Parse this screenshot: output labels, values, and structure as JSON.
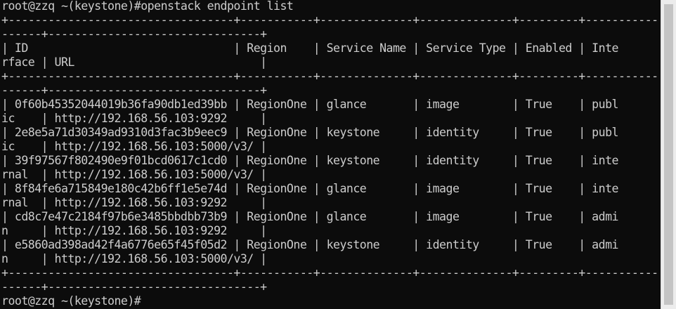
{
  "terminal": {
    "lines": [
      "root@zzq ~(keystone)#openstack endpoint list",
      "+----------------------------------+-----------+--------------+--------------+---------+-----------",
      "------+--------------------------------+",
      "| ID                               | Region    | Service Name | Service Type | Enabled | Inte",
      "rface | URL                            |",
      "+----------------------------------+-----------+--------------+--------------+---------+-----------",
      "------+--------------------------------+",
      "| 0f60b45352044019b36fa90db1ed39bb | RegionOne | glance       | image        | True    | publ",
      "ic    | http://192.168.56.103:9292     |",
      "| 2e8e5a71d30349ad9310d3fac3b9eec9 | RegionOne | keystone     | identity     | True    | publ",
      "ic    | http://192.168.56.103:5000/v3/ |",
      "| 39f97567f802490e9f01bcd0617c1cd0 | RegionOne | keystone     | identity     | True    | inte",
      "rnal  | http://192.168.56.103:5000/v3/ |",
      "| 8f84fe6a715849e180c42b6ff1e5e74d | RegionOne | glance       | image        | True    | inte",
      "rnal  | http://192.168.56.103:9292     |",
      "| cd8c7e47c2184f97b6e3485bbdbb73b9 | RegionOne | glance       | image        | True    | admi",
      "n     | http://192.168.56.103:9292     |",
      "| e5860ad398ad42f4a6776e65f45f05d2 | RegionOne | keystone     | identity     | True    | admi",
      "n     | http://192.168.56.103:5000/v3/ |",
      "+----------------------------------+-----------+--------------+--------------+---------+-----------",
      "------+--------------------------------+",
      "root@zzq ~(keystone)#"
    ]
  }
}
